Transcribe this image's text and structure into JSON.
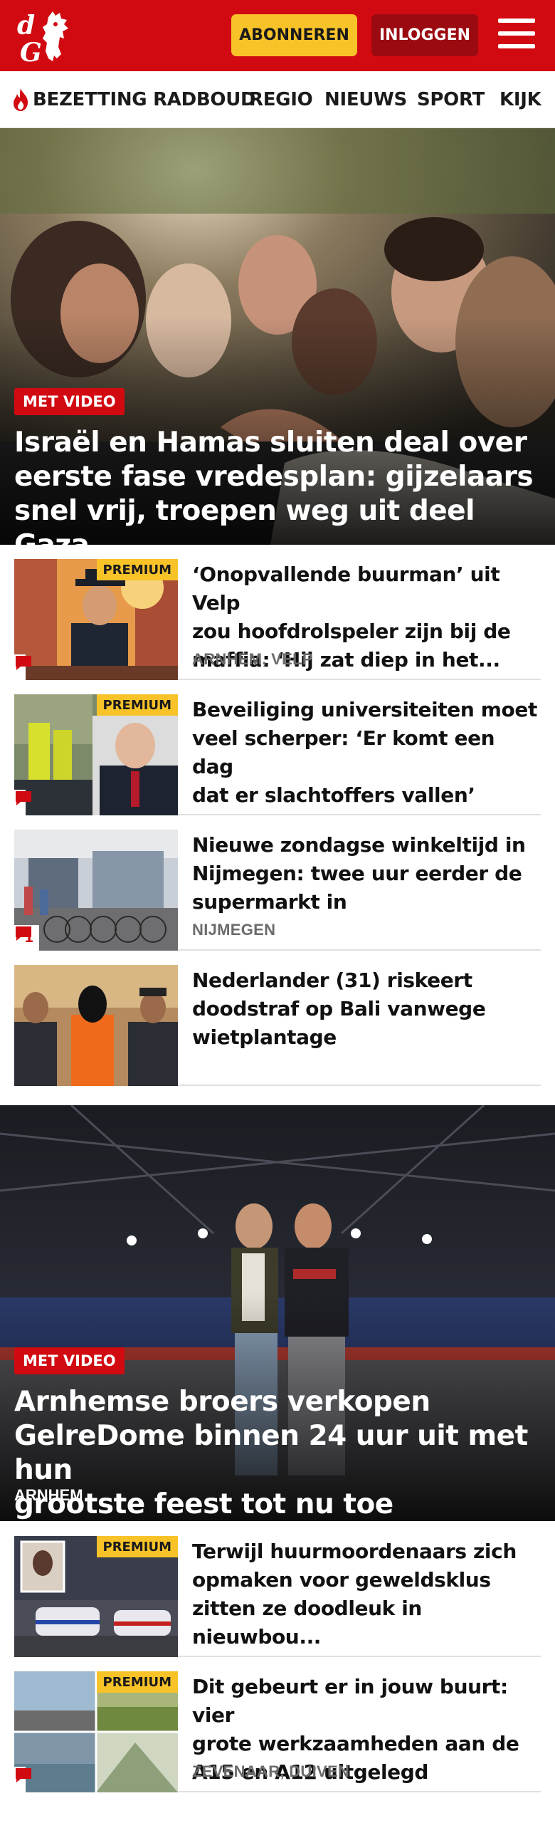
{
  "header": {
    "logo_text": "dG",
    "subscribe_label": "ABONNEREN",
    "login_label": "INLOGGEN",
    "menu_icon": "hamburger-icon",
    "brand_color": "#d10a11"
  },
  "nav": {
    "items": [
      {
        "label": "BEZETTING RADBOUD",
        "icon": "flame-icon"
      },
      {
        "label": "REGIO"
      },
      {
        "label": "NIEUWS"
      },
      {
        "label": "SPORT"
      },
      {
        "label": "KIJK"
      }
    ]
  },
  "hero1": {
    "badge": "MET VIDEO",
    "title_lines": [
      "Israël en Hamas sluiten deal over",
      "eerste fase vredesplan: gijzelaars",
      "snel vrij, troepen weg uit deel Gaza"
    ]
  },
  "articles1": [
    {
      "premium": "PREMIUM",
      "title_lines": [
        "‘Onopvallende buurman’ uit Velp",
        "zou hoofdrolspeler zijn bij de",
        "maffia: ‘Hij zat diep in het..."
      ],
      "location": "ARNHEM, VELP",
      "comments": ""
    },
    {
      "premium": "PREMIUM",
      "title_lines": [
        "Beveiliging universiteiten moet",
        "veel scherper: ‘Er komt een dag",
        "dat er slachtoffers vallen’"
      ],
      "location": "",
      "comments": ""
    },
    {
      "premium": "",
      "title_lines": [
        "Nieuwe zondagse winkeltijd in",
        "Nijmegen: twee uur eerder de",
        "supermarkt in"
      ],
      "location": "NIJMEGEN",
      "comments": "1"
    },
    {
      "premium": "",
      "title_lines": [
        "Nederlander (31) riskeert",
        "doodstraf op Bali vanwege",
        "wietplantage"
      ],
      "location": "",
      "comments": ""
    }
  ],
  "hero2": {
    "badge": "MET VIDEO",
    "title_lines": [
      "Arnhemse broers verkopen",
      "GelreDome binnen 24 uur uit met hun",
      "grootste feest tot nu toe"
    ],
    "location": "ARNHEM"
  },
  "articles2": [
    {
      "premium": "PREMIUM",
      "title_lines": [
        "Terwijl huurmoordenaars zich",
        "opmaken voor geweldsklus",
        "zitten ze doodleuk in nieuwbou..."
      ],
      "location": "",
      "comments": ""
    },
    {
      "premium": "PREMIUM",
      "title_lines": [
        "Dit gebeurt er in jouw buurt: vier",
        "grote werkzaamheden aan de",
        "A15 en A12 uitgelegd"
      ],
      "location": "ZEVENAAR, DUIVEN",
      "comments": ""
    }
  ]
}
